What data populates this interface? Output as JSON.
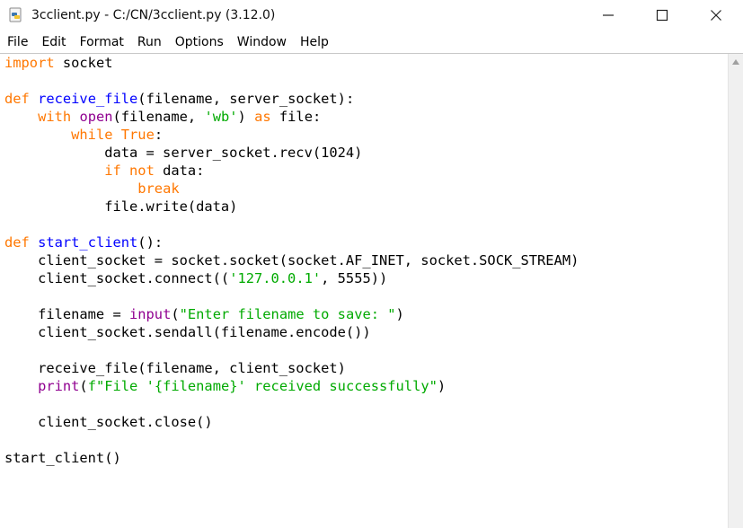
{
  "window": {
    "title": "3cclient.py - C:/CN/3cclient.py (3.12.0)",
    "controls": {
      "minimize": "minimize-icon",
      "maximize": "maximize-icon",
      "close": "close-icon"
    }
  },
  "menu": [
    "File",
    "Edit",
    "Format",
    "Run",
    "Options",
    "Window",
    "Help"
  ],
  "colors": {
    "keyword": "#ff7700",
    "definition": "#0000ff",
    "string": "#00aa00",
    "builtin": "#900090"
  },
  "code": {
    "lines": [
      [
        {
          "t": "import",
          "c": "kw"
        },
        {
          "t": " socket"
        }
      ],
      [],
      [
        {
          "t": "def",
          "c": "kw"
        },
        {
          "t": " "
        },
        {
          "t": "receive_file",
          "c": "def"
        },
        {
          "t": "(filename, server_socket):"
        }
      ],
      [
        {
          "t": "    "
        },
        {
          "t": "with",
          "c": "kw"
        },
        {
          "t": " "
        },
        {
          "t": "open",
          "c": "bi"
        },
        {
          "t": "(filename, "
        },
        {
          "t": "'wb'",
          "c": "str"
        },
        {
          "t": ") "
        },
        {
          "t": "as",
          "c": "kw"
        },
        {
          "t": " file:"
        }
      ],
      [
        {
          "t": "        "
        },
        {
          "t": "while",
          "c": "kw"
        },
        {
          "t": " "
        },
        {
          "t": "True",
          "c": "kw"
        },
        {
          "t": ":"
        }
      ],
      [
        {
          "t": "            data = server_socket.recv(1024)"
        }
      ],
      [
        {
          "t": "            "
        },
        {
          "t": "if",
          "c": "kw"
        },
        {
          "t": " "
        },
        {
          "t": "not",
          "c": "kw"
        },
        {
          "t": " data:"
        }
      ],
      [
        {
          "t": "                "
        },
        {
          "t": "break",
          "c": "kw"
        }
      ],
      [
        {
          "t": "            file.write(data)"
        }
      ],
      [],
      [
        {
          "t": "def",
          "c": "kw"
        },
        {
          "t": " "
        },
        {
          "t": "start_client",
          "c": "def"
        },
        {
          "t": "():"
        }
      ],
      [
        {
          "t": "    client_socket = socket.socket(socket.AF_INET, socket.SOCK_STREAM)"
        }
      ],
      [
        {
          "t": "    client_socket.connect(("
        },
        {
          "t": "'127.0.0.1'",
          "c": "str"
        },
        {
          "t": ", 5555))"
        }
      ],
      [],
      [
        {
          "t": "    filename = "
        },
        {
          "t": "input",
          "c": "bi"
        },
        {
          "t": "("
        },
        {
          "t": "\"Enter filename to save: \"",
          "c": "str"
        },
        {
          "t": ")"
        }
      ],
      [
        {
          "t": "    client_socket.sendall(filename.encode())"
        }
      ],
      [],
      [
        {
          "t": "    receive_file(filename, client_socket)"
        }
      ],
      [
        {
          "t": "    "
        },
        {
          "t": "print",
          "c": "bi"
        },
        {
          "t": "("
        },
        {
          "t": "f\"File '{filename}' received successfully\"",
          "c": "str"
        },
        {
          "t": ")"
        }
      ],
      [],
      [
        {
          "t": "    client_socket.close()"
        }
      ],
      [],
      [
        {
          "t": "start_client()"
        }
      ]
    ]
  }
}
